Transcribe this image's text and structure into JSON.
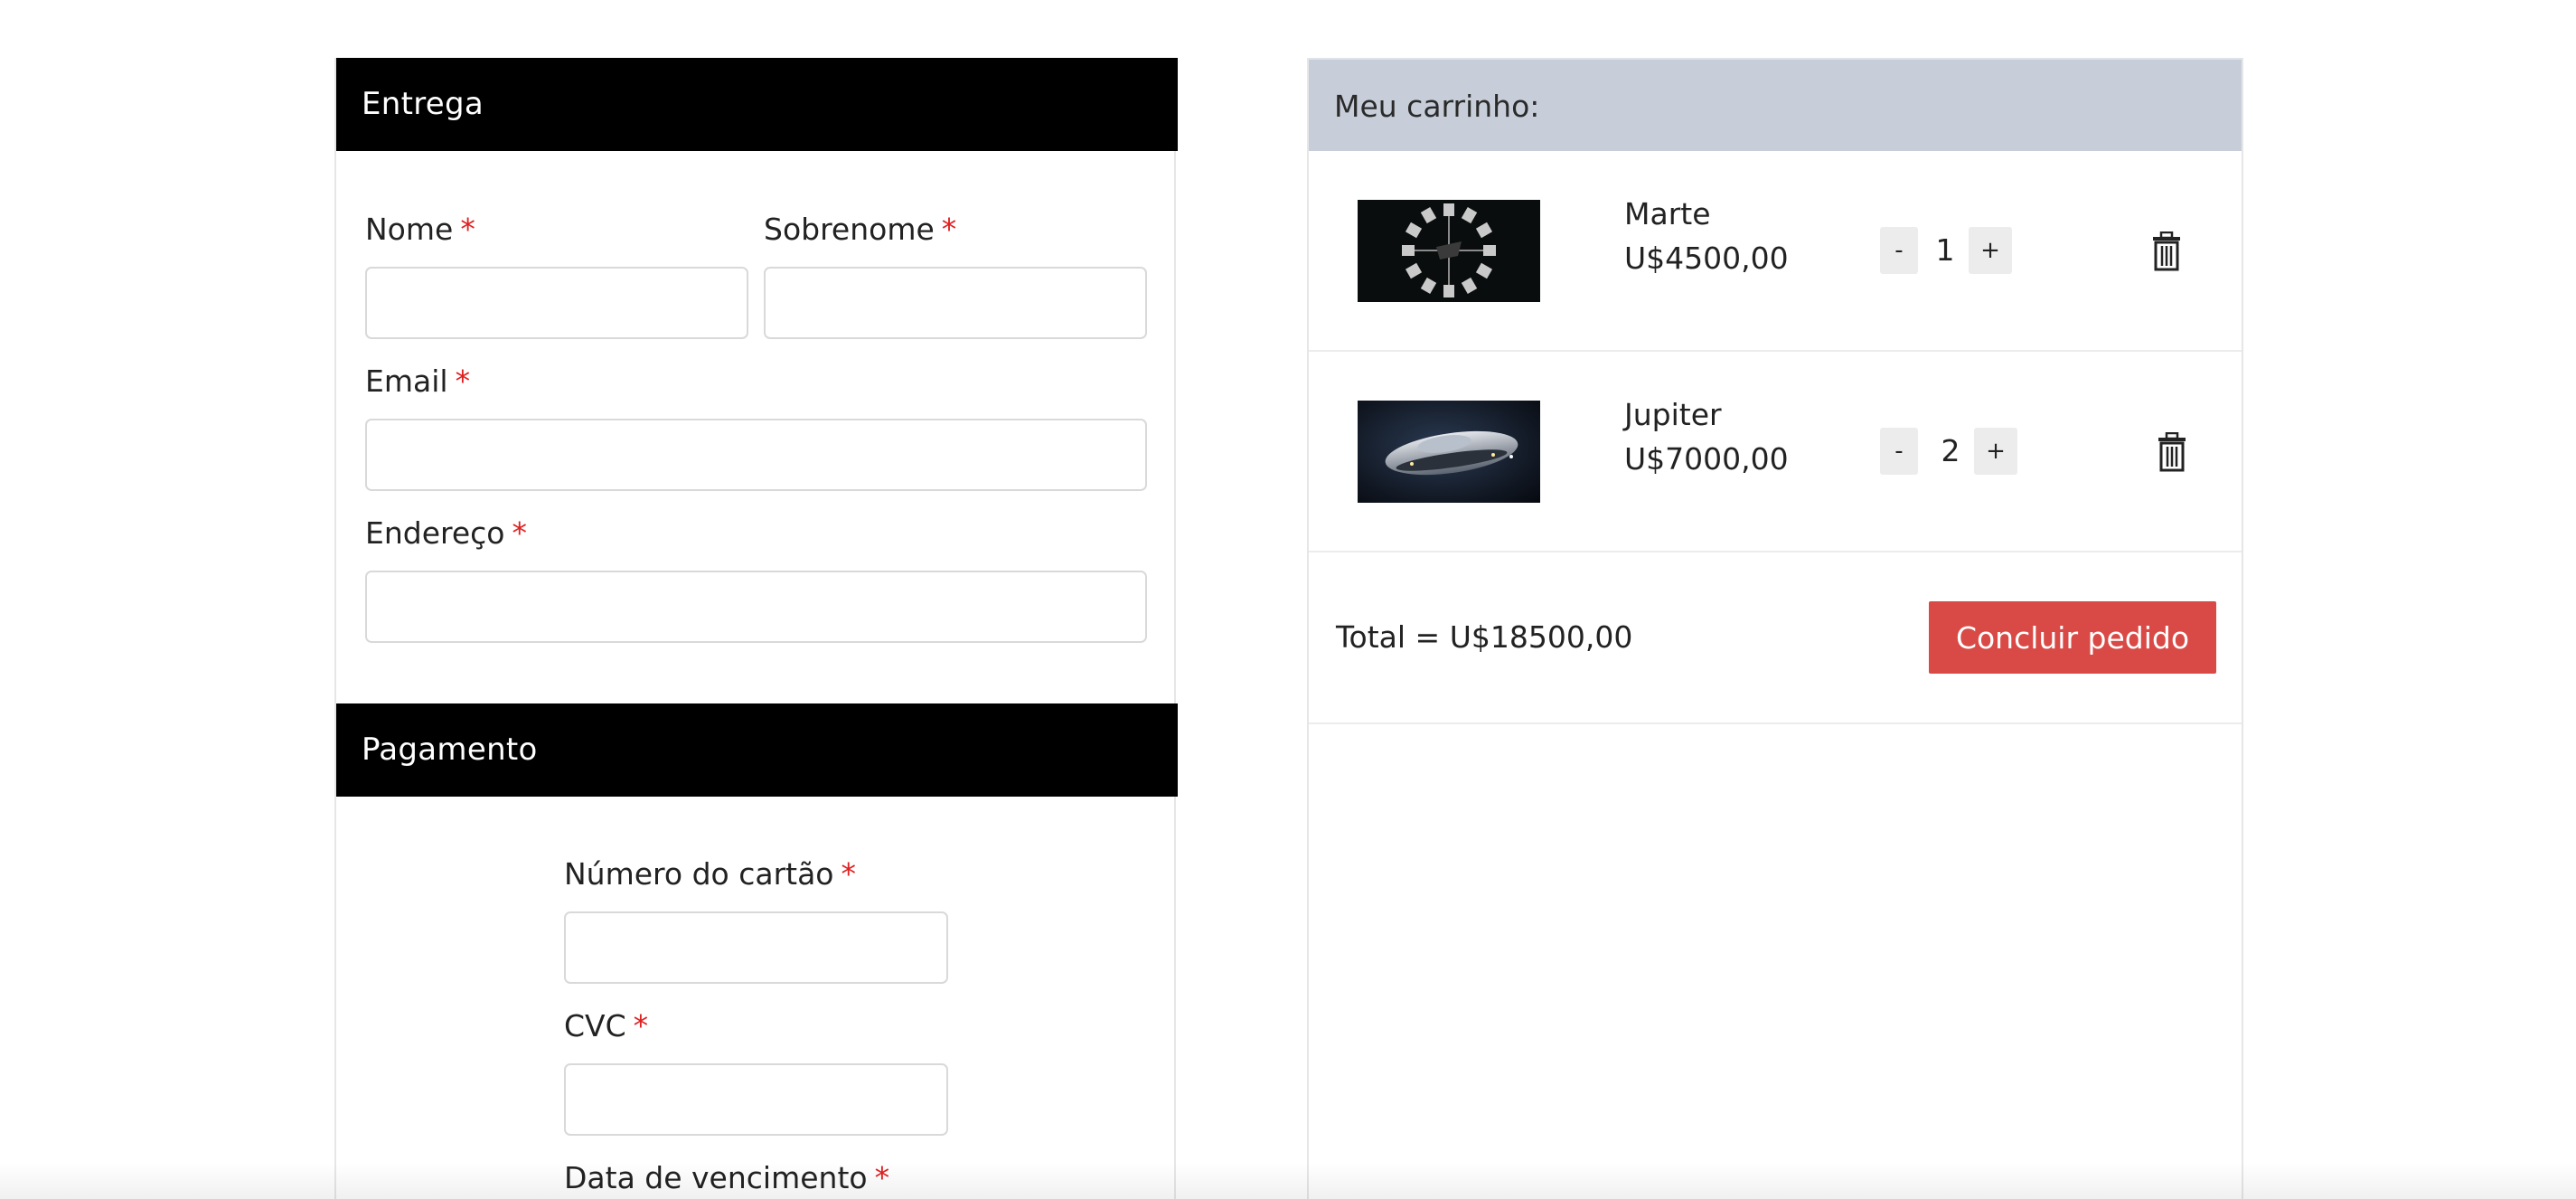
{
  "delivery": {
    "title": "Entrega",
    "required_mark": "*",
    "fields": {
      "first_name": {
        "label": "Nome",
        "value": ""
      },
      "last_name": {
        "label": "Sobrenome",
        "value": ""
      },
      "email": {
        "label": "Email",
        "value": ""
      },
      "address": {
        "label": "Endereço",
        "value": ""
      }
    }
  },
  "payment": {
    "title": "Pagamento",
    "fields": {
      "card_number": {
        "label": "Número do cartão",
        "value": ""
      },
      "cvc": {
        "label": "CVC",
        "value": ""
      },
      "expiry": {
        "label": "Data de vencimento"
      }
    }
  },
  "cart": {
    "title": "Meu carrinho:",
    "items": [
      {
        "name": "Marte",
        "price": "U$4500,00",
        "quantity": "1",
        "minus": "-",
        "plus": "+",
        "image_icon": "wormhole-ship-image"
      },
      {
        "name": "Jupiter",
        "price": "U$7000,00",
        "quantity": "2",
        "minus": "-",
        "plus": "+",
        "image_icon": "spaceship-image"
      }
    ],
    "total": "Total = U$18500,00",
    "checkout_label": "Concluir pedido"
  },
  "colors": {
    "header_bg": "#000000",
    "cart_header_bg": "#c8ced9",
    "checkout_button": "#d94a46",
    "required": "#e02020"
  }
}
